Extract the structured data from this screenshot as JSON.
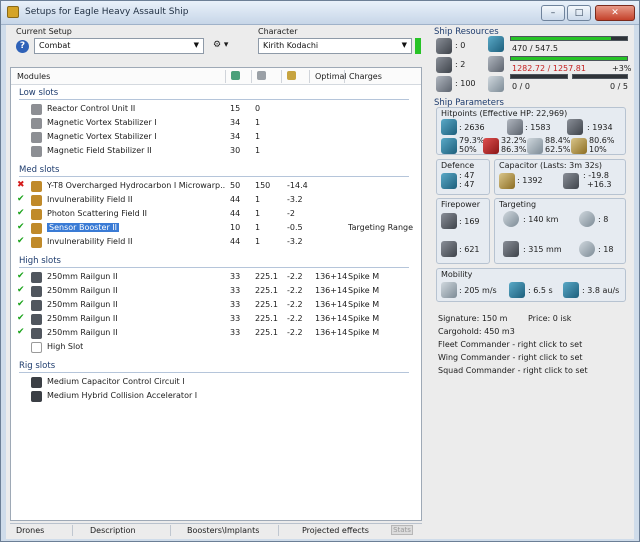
{
  "window": {
    "title": "Setups for Eagle Heavy Assault Ship",
    "buttons": [
      "–",
      "□",
      "✕"
    ]
  },
  "setup": {
    "current_setup_label": "Current Setup",
    "current_setup_value": "Combat",
    "character_label": "Character",
    "character_value": "Kirith Kodachi"
  },
  "modules": {
    "columns": [
      "Modules",
      "",
      "",
      "",
      "Optimal",
      "Charges"
    ],
    "low_slots_label": "Low slots",
    "med_slots_label": "Med slots",
    "high_slots_label": "High slots",
    "rig_slots_label": "Rig slots",
    "low": [
      {
        "status": "",
        "name": "Reactor Control Unit II",
        "c1": "15",
        "c2": "0",
        "c3": "",
        "c4": "",
        "c5": ""
      },
      {
        "status": "",
        "name": "Magnetic Vortex Stabilizer I",
        "c1": "34",
        "c2": "1",
        "c3": "",
        "c4": "",
        "c5": ""
      },
      {
        "status": "",
        "name": "Magnetic Vortex Stabilizer I",
        "c1": "34",
        "c2": "1",
        "c3": "",
        "c4": "",
        "c5": ""
      },
      {
        "status": "",
        "name": "Magnetic Field Stabilizer II",
        "c1": "30",
        "c2": "1",
        "c3": "",
        "c4": "",
        "c5": ""
      }
    ],
    "med": [
      {
        "status": "bad",
        "name": "Y-T8 Overcharged Hydrocarbon I Microwarp...",
        "c1": "50",
        "c2": "150",
        "c3": "-14.4",
        "c4": "",
        "c5": ""
      },
      {
        "status": "ok",
        "name": "Invulnerability Field II",
        "c1": "44",
        "c2": "1",
        "c3": "-3.2",
        "c4": "",
        "c5": ""
      },
      {
        "status": "ok",
        "name": "Photon Scattering Field II",
        "c1": "44",
        "c2": "1",
        "c3": "-2",
        "c4": "",
        "c5": ""
      },
      {
        "status": "ok",
        "name": "Sensor Booster II",
        "c1": "10",
        "c2": "1",
        "c3": "-0.5",
        "c4": "",
        "c5": "Targeting Range",
        "selected": true
      },
      {
        "status": "ok",
        "name": "Invulnerability Field II",
        "c1": "44",
        "c2": "1",
        "c3": "-3.2",
        "c4": "",
        "c5": ""
      }
    ],
    "high": [
      {
        "status": "ok",
        "name": "250mm Railgun II",
        "c1": "33",
        "c2": "225.1",
        "c3": "-2.2",
        "c4": "136+14",
        "c5": "Spike M"
      },
      {
        "status": "ok",
        "name": "250mm Railgun II",
        "c1": "33",
        "c2": "225.1",
        "c3": "-2.2",
        "c4": "136+14",
        "c5": "Spike M"
      },
      {
        "status": "ok",
        "name": "250mm Railgun II",
        "c1": "33",
        "c2": "225.1",
        "c3": "-2.2",
        "c4": "136+14",
        "c5": "Spike M"
      },
      {
        "status": "ok",
        "name": "250mm Railgun II",
        "c1": "33",
        "c2": "225.1",
        "c3": "-2.2",
        "c4": "136+14",
        "c5": "Spike M"
      },
      {
        "status": "ok",
        "name": "250mm Railgun II",
        "c1": "33",
        "c2": "225.1",
        "c3": "-2.2",
        "c4": "136+14",
        "c5": "Spike M"
      },
      {
        "status": "",
        "name": "High Slot",
        "c1": "",
        "c2": "",
        "c3": "",
        "c4": "",
        "c5": "",
        "empty": true
      }
    ],
    "rig": [
      {
        "status": "",
        "name": "Medium Capacitor Control Circuit I"
      },
      {
        "status": "",
        "name": "Medium Hybrid Collision Accelerator I"
      }
    ]
  },
  "bottom_tabs": [
    "Drones",
    "Description",
    "Boosters\\Implants",
    "Projected effects",
    "Stats"
  ],
  "resources": {
    "title": "Ship Resources",
    "turret": ": 0",
    "launcher": ": 2",
    "calib": ": 100",
    "cpu": "470 / 547.5",
    "cpu_fraction": 0.86,
    "pg": "1282.72 / 1257.81",
    "pg_over": "+3%",
    "pg_fraction": 1.0,
    "drone_bay": "0 / 0",
    "drone_bw": "0 / 5"
  },
  "params": {
    "title": "Ship Parameters",
    "hitpoints_label": "Hitpoints (Effective HP: 22,969)",
    "shield_hp": ": 2636",
    "armor_hp": ": 1583",
    "structure_hp": ": 1934",
    "resists": {
      "em": [
        "79.3%",
        "50%"
      ],
      "therm": [
        "32.2%",
        "86.3%"
      ],
      "kin": [
        "88.4%",
        "62.5%"
      ],
      "exp": [
        "80.6%",
        "10%"
      ]
    },
    "defence_label": "Defence",
    "defence_top": ": 47",
    "defence_bottom": ": 47",
    "capacitor_label": "Capacitor (Lasts: 3m 32s)",
    "cap_amount": ": 1392",
    "cap_rate1": ": -19.8",
    "cap_rate2": "+16.3",
    "firepower_label": "Firepower",
    "fire1": ": 169",
    "fire2": ": 621",
    "targeting_label": "Targeting",
    "range": ": 140 km",
    "max_targets": ": 8",
    "scan_res": ": 315 mm",
    "sensor_str": ": 18",
    "mobility_label": "Mobility",
    "speed": ": 205 m/s",
    "align": ": 6.5 s",
    "warp": ": 3.8 au/s"
  },
  "info": {
    "signature": "Signature: 150 m",
    "price": "Price: 0 isk",
    "cargohold": "Cargohold: 450 m3",
    "fleet": "Fleet Commander - right click to set",
    "wing": "Wing Commander - right click to set",
    "squad": "Squad Commander - right click to set"
  },
  "colors": {
    "ok": "#1aa31a",
    "bad": "#d41a1a",
    "selection": "#3a7bd5",
    "bar_fill": "#27c327",
    "over": "#c42020"
  }
}
